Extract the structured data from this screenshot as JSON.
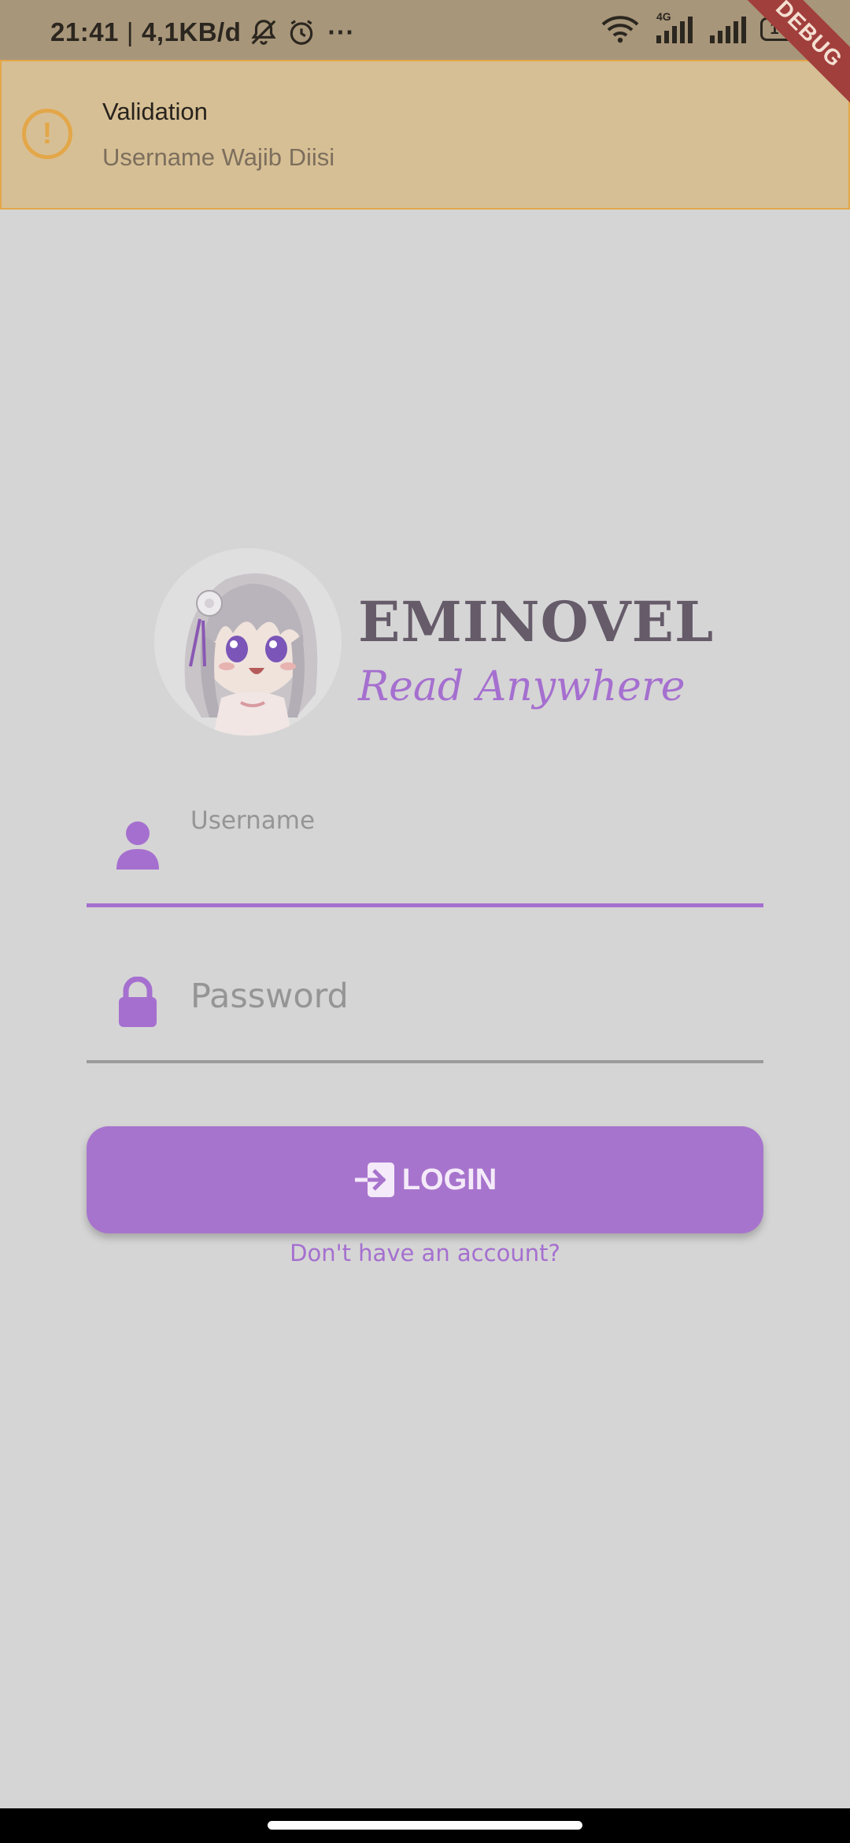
{
  "status_bar": {
    "time": "21:41",
    "separator": "|",
    "network_speed": "4,1KB/d",
    "overflow": "···",
    "network_type": "4G",
    "battery": "100",
    "icons": [
      "bell-off-icon",
      "alarm-icon",
      "wifi-icon",
      "signal-icon",
      "battery-icon"
    ]
  },
  "debug_banner": "DEBUG",
  "toast": {
    "icon": "warning-icon",
    "icon_glyph": "!",
    "title": "Validation",
    "message": "Username Wajib Diisi",
    "accent": "#e3a749"
  },
  "brand": {
    "title": "EMINOVEL",
    "tagline": "Read Anywhere",
    "title_color": "#655b69",
    "accent": "#a56fcf"
  },
  "form": {
    "username": {
      "label": "Username",
      "value": "",
      "icon": "user-icon"
    },
    "password": {
      "label": "Password",
      "value": "",
      "icon": "lock-icon"
    },
    "login_button": {
      "label": "LOGIN",
      "icon": "login-icon",
      "color": "#a774cd"
    },
    "signup_link": "Don't have an account?"
  }
}
